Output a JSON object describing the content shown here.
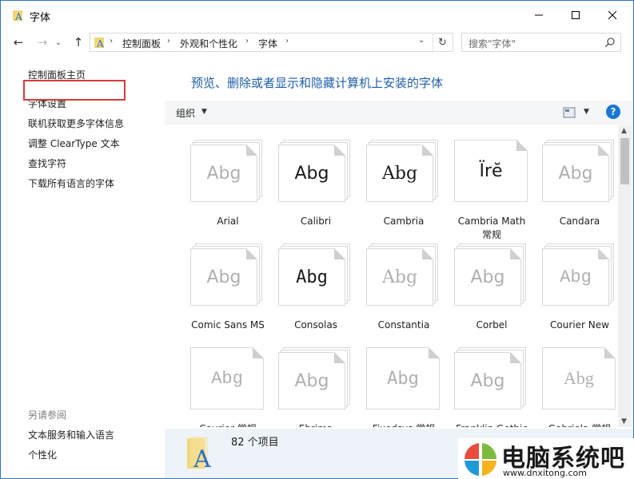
{
  "window": {
    "title": "字体",
    "controls": {
      "minimize": "—",
      "maximize": "☐",
      "close": "✕"
    }
  },
  "nav": {
    "back": "←",
    "forward": "→",
    "up": "↑",
    "breadcrumbs": [
      "控制面板",
      "外观和个性化",
      "字体"
    ],
    "refresh": "↻",
    "search_placeholder": "搜索\"字体\""
  },
  "left_pane": {
    "links": [
      "控制面板主页",
      "字体设置",
      "联机获取更多字体信息",
      "调整 ClearType 文本",
      "查找字符",
      "下载所有语言的字体"
    ],
    "see_also_title": "另请参阅",
    "see_also": [
      "文本服务和输入语言",
      "个性化"
    ]
  },
  "content": {
    "heading": "预览、删除或者显示和隐藏计算机上安装的字体",
    "toolbar": {
      "organize": "组织",
      "help": "?"
    },
    "fonts": [
      {
        "name": "Arial",
        "sample": "Abg",
        "style": "light",
        "stack": true
      },
      {
        "name": "Calibri",
        "sample": "Abg",
        "style": "dark",
        "stack": true
      },
      {
        "name": "Cambria",
        "sample": "Abg",
        "style": "dark",
        "stack": true
      },
      {
        "name": "Cambria Math\n常规",
        "sample": "Ïrĕ",
        "style": "dark",
        "stack": false
      },
      {
        "name": "Candara",
        "sample": "Abg",
        "style": "light",
        "stack": true
      },
      {
        "name": "Comic Sans MS",
        "sample": "Abg",
        "style": "light",
        "stack": true
      },
      {
        "name": "Consolas",
        "sample": "Abg",
        "style": "dark",
        "stack": true
      },
      {
        "name": "Constantia",
        "sample": "Abg",
        "style": "light",
        "stack": true
      },
      {
        "name": "Corbel",
        "sample": "Abg",
        "style": "light",
        "stack": true
      },
      {
        "name": "Courier New",
        "sample": "Abg",
        "style": "light",
        "stack": true
      },
      {
        "name": "Courier 常规",
        "sample": "Abg",
        "style": "light",
        "stack": false
      },
      {
        "name": "Ebrima",
        "sample": "Abg",
        "style": "light",
        "stack": true
      },
      {
        "name": "Fixedsys 常规",
        "sample": "Abg",
        "style": "light",
        "stack": false
      },
      {
        "name": "Franklin Gothic",
        "sample": "Abg",
        "style": "light",
        "stack": true
      },
      {
        "name": "Gabriola 常规",
        "sample": "Abg",
        "style": "light",
        "stack": false
      }
    ],
    "status": "82 个项目"
  },
  "watermark": {
    "text": "电脑系统吧",
    "url": "www.dnxitong.com"
  },
  "colors": {
    "accent": "#1e5ea8",
    "highlight": "#d63b3b",
    "status_bg": "#eef3fa"
  }
}
